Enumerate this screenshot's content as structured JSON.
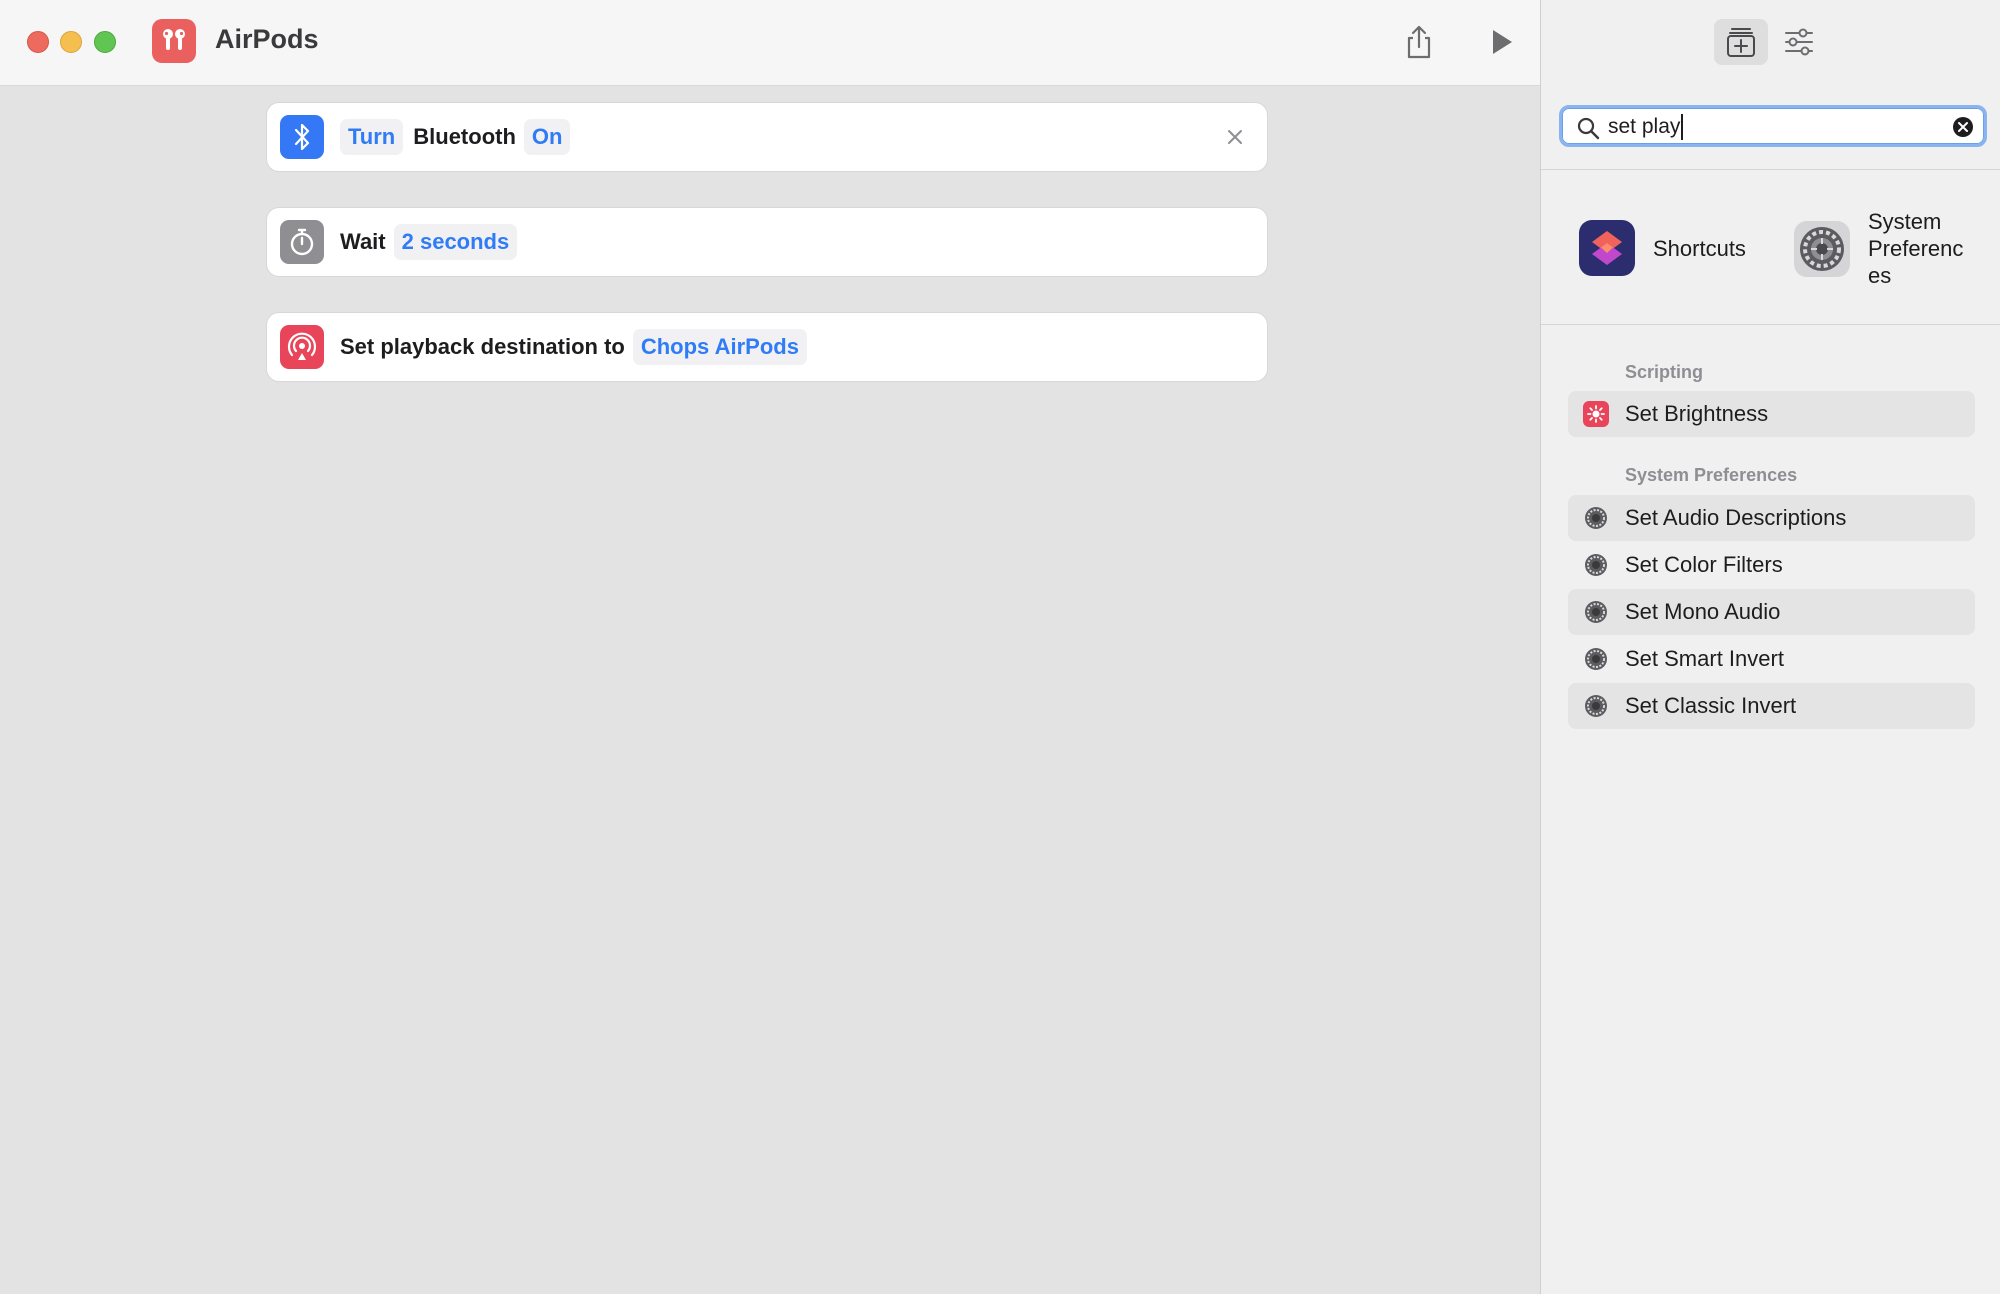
{
  "window": {
    "title": "AirPods"
  },
  "actions": [
    {
      "icon": "bluetooth-icon",
      "label": "Turn",
      "label_is_token": true,
      "middle": "Bluetooth",
      "token": "On"
    },
    {
      "icon": "timer-icon",
      "label": "Wait",
      "token": "2 seconds"
    },
    {
      "icon": "airplay-audio-icon",
      "label": "Set playback destination to",
      "token": "Chops AirPods"
    }
  ],
  "sidebar": {
    "search": {
      "value": "set play"
    },
    "apps": [
      {
        "icon": "shortcuts-app-icon",
        "label": "Shortcuts"
      },
      {
        "icon": "system-preferences-app-icon",
        "label_lines": [
          "System",
          "Preferenc",
          "es"
        ]
      }
    ],
    "sections": [
      {
        "heading": "Scripting",
        "items": [
          {
            "icon": "brightness-icon",
            "label": "Set Brightness"
          }
        ]
      },
      {
        "heading": "System Preferences",
        "items": [
          {
            "icon": "system-preferences-icon",
            "label": "Set Audio Descriptions"
          },
          {
            "icon": "system-preferences-icon",
            "label": "Set Color Filters"
          },
          {
            "icon": "system-preferences-icon",
            "label": "Set Mono Audio"
          },
          {
            "icon": "system-preferences-icon",
            "label": "Set Smart Invert"
          },
          {
            "icon": "system-preferences-icon",
            "label": "Set Classic Invert"
          }
        ]
      }
    ]
  },
  "colors": {
    "accent_blue": "#2f7cf6",
    "bluetooth_bg": "#3478f6",
    "timer_bg": "#8e8e93",
    "airplay_bg": "#e8455a",
    "brightness_bg": "#e8455a"
  }
}
